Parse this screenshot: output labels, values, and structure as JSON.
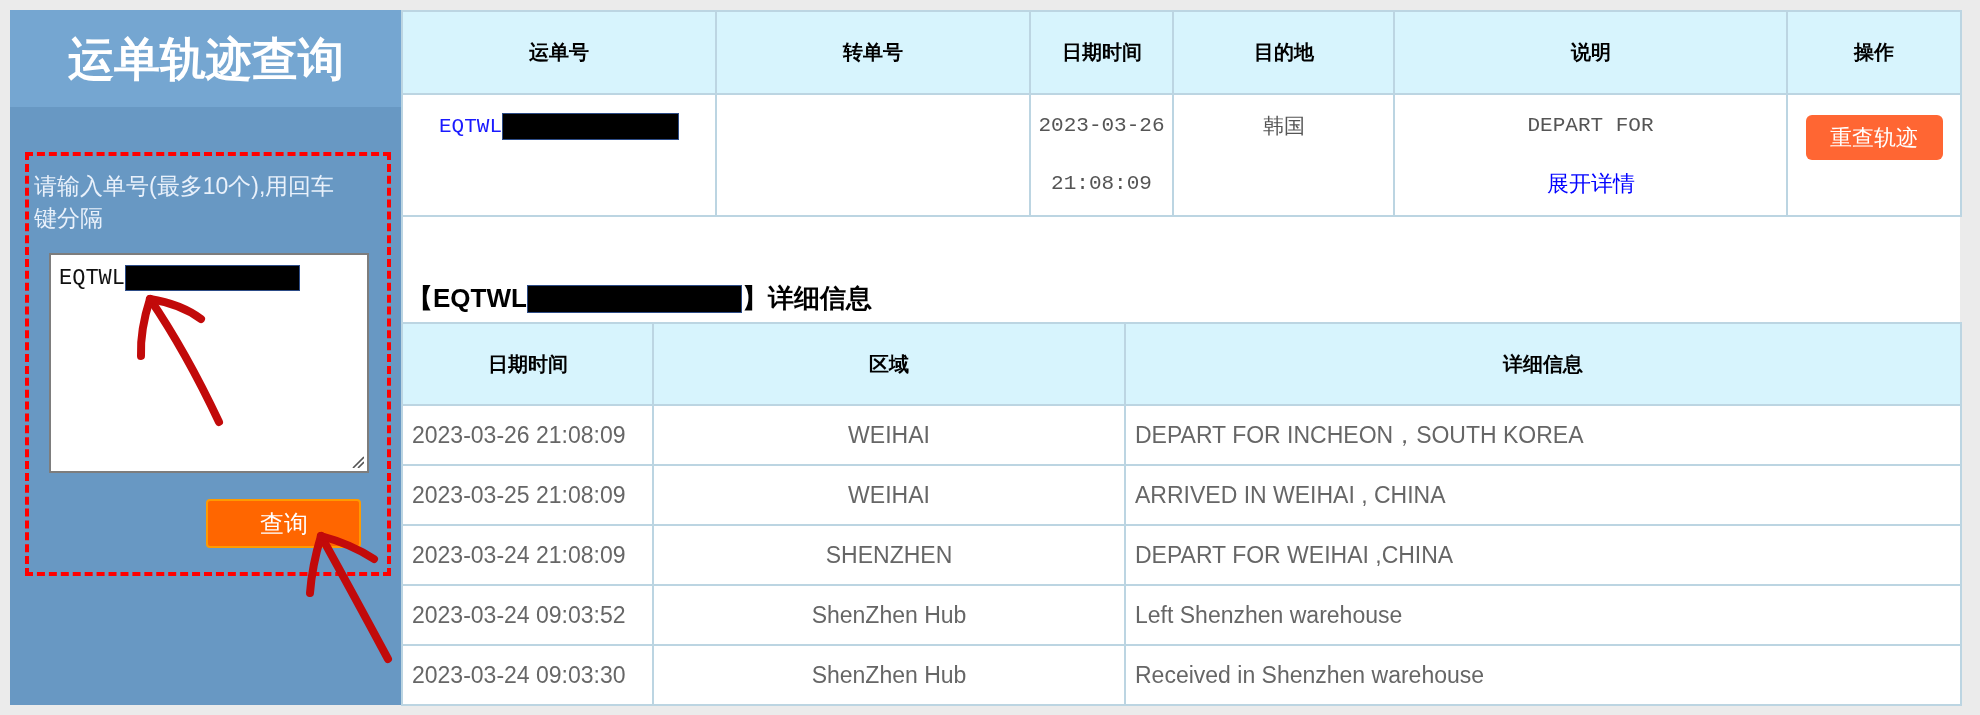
{
  "sidebar": {
    "title": "运单轨迹查询",
    "prompt": "请输入单号(最多10个),用回车键分隔",
    "input": {
      "value": "EQTWL",
      "redacted": true
    },
    "button": "查询"
  },
  "summary": {
    "columns": [
      "运单号",
      "转单号",
      "日期时间",
      "目的地",
      "说明",
      "操作"
    ],
    "rows": [
      {
        "waybill": "EQTWL",
        "waybill_redacted": true,
        "date": "2023-03-26",
        "time": "21:08:09",
        "destination": "韩国",
        "description": "DEPART FOR",
        "details_link": "展开详情",
        "action": "重查轨迹"
      }
    ]
  },
  "detail": {
    "heading_prefix": "【EQTWL",
    "heading_redacted": true,
    "heading_suffix": "】详细信息",
    "columns": [
      "日期时间",
      "区域",
      "详细信息"
    ],
    "rows": [
      {
        "datetime": "2023-03-26 21:08:09",
        "area": "WEIHAI",
        "info": "DEPART FOR INCHEON，SOUTH KOREA"
      },
      {
        "datetime": "2023-03-25 21:08:09",
        "area": "WEIHAI",
        "info": "ARRIVED IN WEIHAI , CHINA"
      },
      {
        "datetime": "2023-03-24 21:08:09",
        "area": "SHENZHEN",
        "info": "DEPART FOR WEIHAI ,CHINA"
      },
      {
        "datetime": "2023-03-24 09:03:52",
        "area": "ShenZhen Hub",
        "info": "Left Shenzhen warehouse"
      },
      {
        "datetime": "2023-03-24 09:03:30",
        "area": "ShenZhen Hub",
        "info": "Received in Shenzhen warehouse"
      }
    ]
  }
}
